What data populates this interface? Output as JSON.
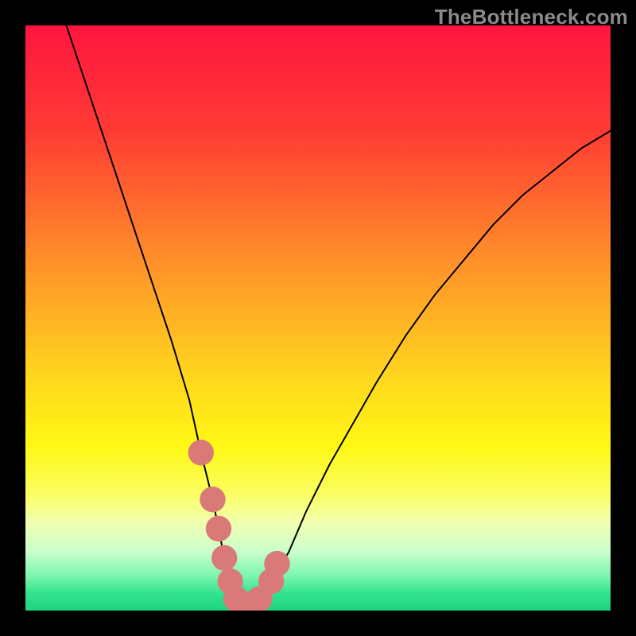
{
  "watermark": "TheBottleneck.com",
  "chart_data": {
    "type": "line",
    "title": "",
    "xlabel": "",
    "ylabel": "",
    "xlim": [
      0,
      100
    ],
    "ylim": [
      0,
      100
    ],
    "gradient_stops": [
      {
        "offset": 0.0,
        "color": "#ff153f"
      },
      {
        "offset": 0.18,
        "color": "#ff3b34"
      },
      {
        "offset": 0.4,
        "color": "#ff8f2a"
      },
      {
        "offset": 0.6,
        "color": "#ffd61e"
      },
      {
        "offset": 0.72,
        "color": "#fff814"
      },
      {
        "offset": 0.8,
        "color": "#fbff62"
      },
      {
        "offset": 0.85,
        "color": "#f1ffb0"
      },
      {
        "offset": 0.9,
        "color": "#c8ffcc"
      },
      {
        "offset": 0.94,
        "color": "#7cf6b0"
      },
      {
        "offset": 0.97,
        "color": "#34e38f"
      },
      {
        "offset": 1.0,
        "color": "#1fd47f"
      }
    ],
    "series": [
      {
        "name": "bottleneck-curve",
        "style": "black-thin",
        "x": [
          7,
          10,
          13,
          16,
          19,
          22,
          25,
          28,
          30,
          32,
          33,
          34,
          35,
          36,
          37,
          38,
          40,
          42,
          45,
          48,
          52,
          56,
          60,
          65,
          70,
          75,
          80,
          85,
          90,
          95,
          100
        ],
        "y": [
          100,
          91,
          82,
          73,
          64,
          55,
          46,
          36,
          27,
          19,
          14,
          9,
          5,
          2,
          1,
          1,
          2,
          5,
          10,
          17,
          25,
          32,
          39,
          47,
          54,
          60,
          66,
          71,
          75,
          79,
          82
        ]
      }
    ],
    "markers": {
      "name": "highlight-dots",
      "color": "#d97a78",
      "radius": 2.2,
      "x": [
        30,
        32,
        33,
        34,
        35,
        36,
        37,
        38,
        40,
        42,
        43
      ],
      "y": [
        27,
        19,
        14,
        9,
        5,
        2,
        1,
        1,
        2,
        5,
        8
      ]
    }
  }
}
